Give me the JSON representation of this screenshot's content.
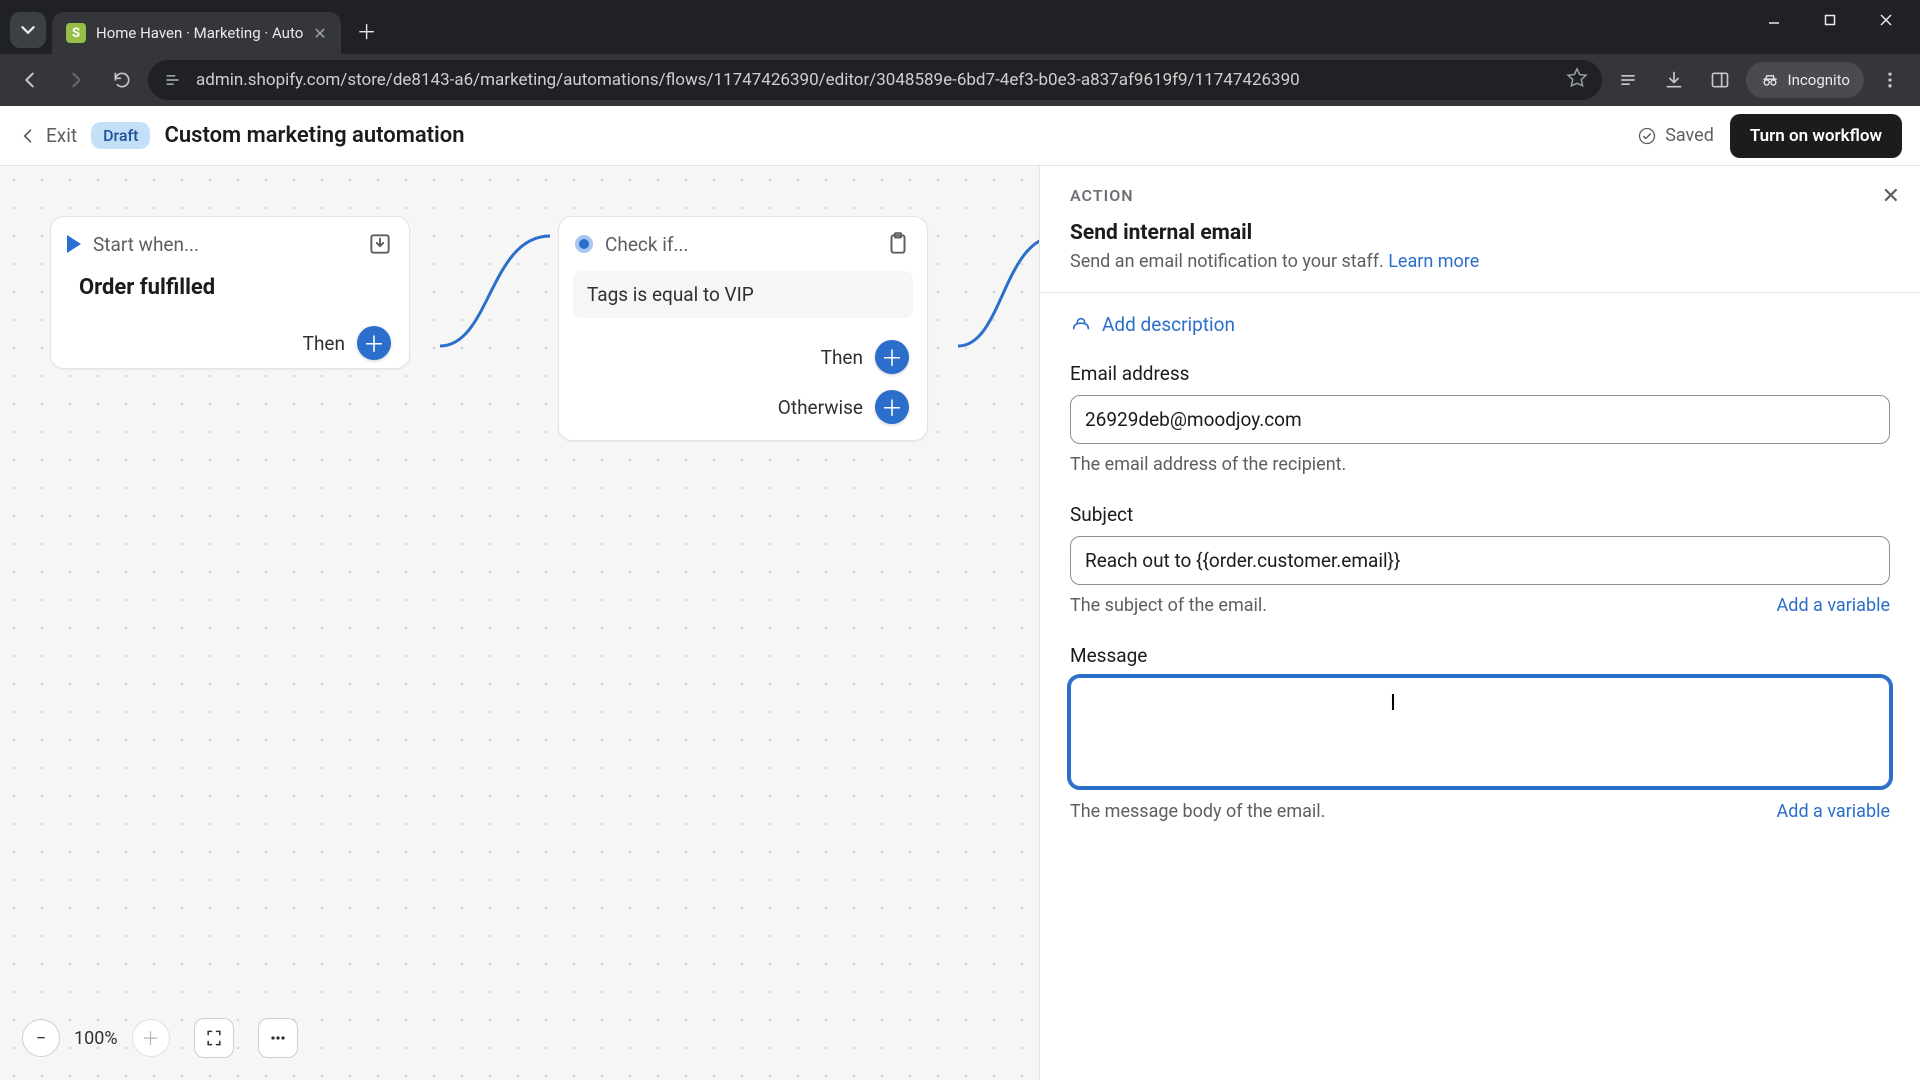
{
  "browser": {
    "tab_title": "Home Haven · Marketing · Auto",
    "url": "admin.shopify.com/store/de8143-a6/marketing/automations/flows/11747426390/editor/3048589e-6bd7-4ef3-b0e3-a837af9619f9/11747426390",
    "incognito_label": "Incognito"
  },
  "header": {
    "exit": "Exit",
    "status_badge": "Draft",
    "title": "Custom marketing automation",
    "saved": "Saved",
    "primary_action": "Turn on workflow"
  },
  "canvas": {
    "start_node": {
      "label": "Start when...",
      "title": "Order fulfilled",
      "then": "Then"
    },
    "check_node": {
      "label": "Check if...",
      "condition": "Tags is equal to VIP",
      "then": "Then",
      "otherwise": "Otherwise"
    },
    "zoom": "100%"
  },
  "panel": {
    "kicker": "ACTION",
    "title": "Send internal email",
    "subtitle": "Send an email notification to your staff. ",
    "learn_more": "Learn more",
    "add_description": "Add description",
    "fields": {
      "email": {
        "label": "Email address",
        "value": "26929deb@moodjoy.com",
        "help": "The email address of the recipient."
      },
      "subject": {
        "label": "Subject",
        "value": "Reach out to {{order.customer.email}}",
        "help": "The subject of the email.",
        "add_variable": "Add a variable"
      },
      "message": {
        "label": "Message",
        "value": "",
        "help": "The message body of the email.",
        "add_variable": "Add a variable"
      }
    }
  }
}
